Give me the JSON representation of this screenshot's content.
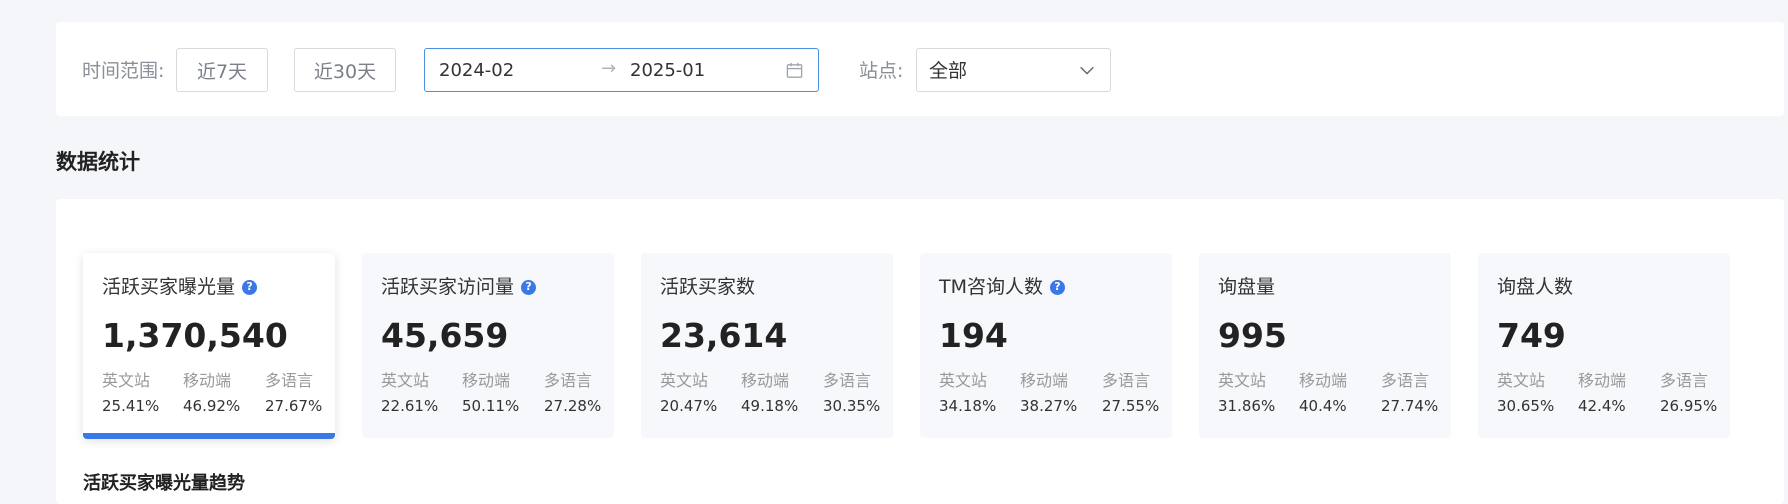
{
  "filters": {
    "time_label": "时间范围:",
    "btn_7d": "近7天",
    "btn_30d": "近30天",
    "date_start": "2024-02",
    "date_sep": "→",
    "date_end": "2025-01",
    "site_label": "站点:",
    "site_value": "全部"
  },
  "section_title": "数据统计",
  "sub_labels": [
    "英文站",
    "移动端",
    "多语言"
  ],
  "cards": [
    {
      "title": "活跃买家曝光量",
      "help": true,
      "value": "1,370,540",
      "pct": [
        "25.41%",
        "46.92%",
        "27.67%"
      ]
    },
    {
      "title": "活跃买家访问量",
      "help": true,
      "value": "45,659",
      "pct": [
        "22.61%",
        "50.11%",
        "27.28%"
      ]
    },
    {
      "title": "活跃买家数",
      "help": false,
      "value": "23,614",
      "pct": [
        "20.47%",
        "49.18%",
        "30.35%"
      ]
    },
    {
      "title": "TM咨询人数",
      "help": true,
      "value": "194",
      "pct": [
        "34.18%",
        "38.27%",
        "27.55%"
      ]
    },
    {
      "title": "询盘量",
      "help": false,
      "value": "995",
      "pct": [
        "31.86%",
        "40.4%",
        "27.74%"
      ]
    },
    {
      "title": "询盘人数",
      "help": false,
      "value": "749",
      "pct": [
        "30.65%",
        "42.4%",
        "26.95%"
      ]
    }
  ],
  "help_glyph": "?",
  "trend_title": "活跃买家曝光量趋势",
  "colors": {
    "accent": "#3b78e7",
    "card_bg": "#f7f8fb",
    "page_bg": "#f5f6fa"
  }
}
